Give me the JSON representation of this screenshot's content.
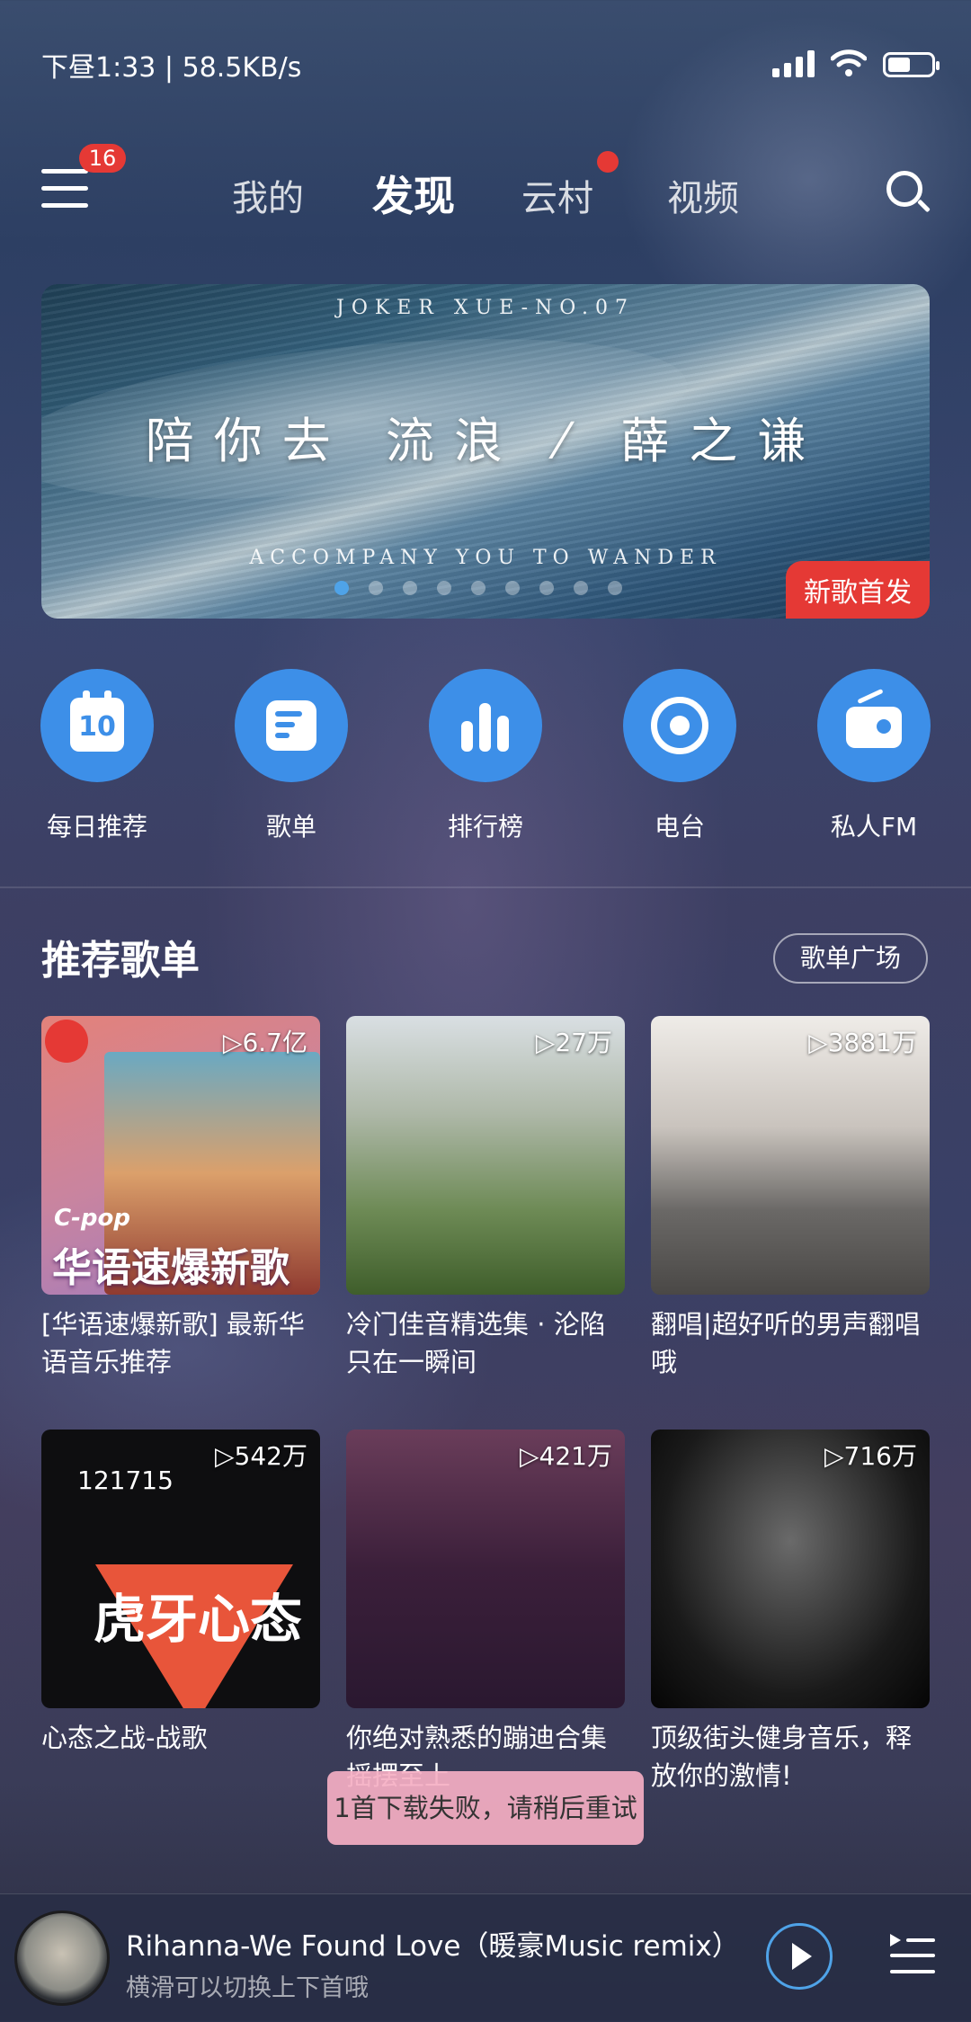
{
  "status": {
    "time": "下昼1:33",
    "speed": "58.5KB/s"
  },
  "nav": {
    "badge": "16",
    "tabs": [
      {
        "label": "我的"
      },
      {
        "label": "发现"
      },
      {
        "label": "云村"
      },
      {
        "label": "视频"
      }
    ],
    "active_tab": "发现"
  },
  "banner": {
    "top_text": "JOKER XUE-NO.07",
    "title": "陪你去 流浪 ⁄ 薛之谦",
    "subtitle": "ACCOMPANY YOU TO WANDER",
    "tag": "新歌首发",
    "dots_total": 9,
    "dots_active": 1
  },
  "quick": [
    {
      "label": "每日推荐",
      "icon": "calendar-icon",
      "day": "10"
    },
    {
      "label": "歌单",
      "icon": "playlist-icon"
    },
    {
      "label": "排行榜",
      "icon": "chart-bars-icon"
    },
    {
      "label": "电台",
      "icon": "radio-podcast-icon"
    },
    {
      "label": "私人FM",
      "icon": "radio-fm-icon"
    }
  ],
  "section": {
    "title": "推荐歌单",
    "button": "歌单广场"
  },
  "playlists": [
    {
      "plays": "▷6.7亿",
      "title": "[华语速爆新歌] 最新华语音乐推荐",
      "cover_tag1": "C-pop",
      "cover_tag2": "华语速爆新歌"
    },
    {
      "plays": "▷27万",
      "title": "冷门佳音精选集 · 沦陷只在一瞬间"
    },
    {
      "plays": "▷3881万",
      "title": "翻唱|超好听的男声翻唱哦"
    },
    {
      "plays": "▷542万",
      "title": "心态之战-战歌",
      "cover_tag1": "121715",
      "cover_tag2": "虎牙心态"
    },
    {
      "plays": "▷421万",
      "title": "你绝对熟悉的蹦迪合集 摇摆至上"
    },
    {
      "plays": "▷716万",
      "title": "顶级街头健身音乐，释放你的激情!"
    }
  ],
  "toast": "1首下载失败，请稍后重试",
  "player": {
    "title": "Rihanna-We Found Love（暖豪Music remix）",
    "subtitle": "横滑可以切换上下首哦"
  },
  "colors": {
    "accent": "#3d8fe8",
    "red": "#e53935"
  }
}
